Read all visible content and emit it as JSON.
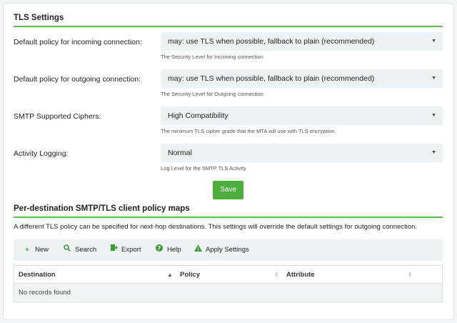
{
  "tls_settings": {
    "title": "TLS Settings",
    "fields": [
      {
        "label": "Default policy for incoming connection:",
        "value": "may: use TLS when possible, fallback to plain (recommended)",
        "help": "The Security Level for Incoming connection"
      },
      {
        "label": "Default policy for outgoing connection:",
        "value": "may: use TLS when possible, fallback to plain (recommended)",
        "help": "The Security Level for Outgoing connection"
      },
      {
        "label": "SMTP Supported Ciphers:",
        "value": "High Compatibility",
        "help": "The minimum TLS cipher grade that the MTA will use with TLS encryption."
      },
      {
        "label": "Activity Logging:",
        "value": "Normal",
        "help": "Log Level for the SMTP TLS Activity"
      }
    ],
    "save_label": "Save"
  },
  "policy_maps": {
    "title": "Per-destination SMTP/TLS client policy maps",
    "description": "A different TLS policy can be specified for next-hop destinations. This settings will override the default settings for outgoing connection.",
    "toolbar": [
      {
        "label": "New",
        "icon": "plus-icon"
      },
      {
        "label": "Search",
        "icon": "search-icon"
      },
      {
        "label": "Export",
        "icon": "export-icon"
      },
      {
        "label": "Help",
        "icon": "help-icon"
      },
      {
        "label": "Apply Settings",
        "icon": "warning-icon"
      }
    ],
    "columns": [
      "Destination",
      "Policy",
      "Attribute"
    ],
    "empty_text": "No records found"
  },
  "colors": {
    "accent": "#5bbf47",
    "save_button": "#4caf3c",
    "input_bg": "#eef1f4"
  }
}
